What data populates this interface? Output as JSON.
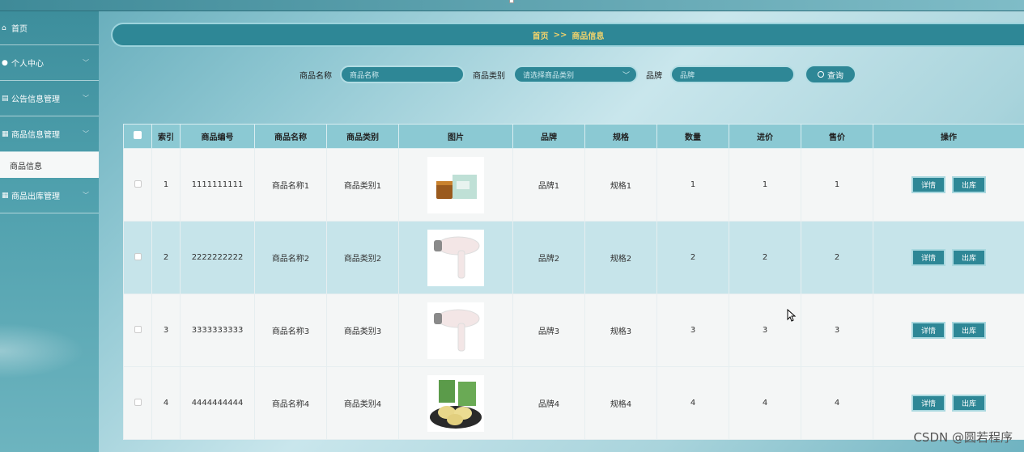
{
  "sidebar": {
    "items": [
      {
        "label": "首页",
        "icon": "home-icon"
      },
      {
        "label": "个人中心",
        "icon": "user-icon"
      },
      {
        "label": "公告信息管理",
        "icon": "notice-icon"
      },
      {
        "label": "商品信息管理",
        "icon": "grid-icon"
      },
      {
        "label": "商品出库管理",
        "icon": "grid-icon"
      }
    ],
    "sub_item": "商品信息"
  },
  "breadcrumb": {
    "home": "首页",
    "sep": ">>",
    "current": "商品信息"
  },
  "search": {
    "name_label": "商品名称",
    "name_placeholder": "商品名称",
    "category_label": "商品类别",
    "category_placeholder": "请选择商品类别",
    "brand_label": "品牌",
    "brand_placeholder": "品牌",
    "button": "查询"
  },
  "table": {
    "headers": [
      "索引",
      "商品编号",
      "商品名称",
      "商品类别",
      "图片",
      "品牌",
      "规格",
      "数量",
      "进价",
      "售价",
      "操作"
    ],
    "rows": [
      {
        "index": "1",
        "code": "1111111111",
        "name": "商品名称1",
        "category": "商品类别1",
        "image": "cosmetics-image",
        "brand": "品牌1",
        "spec": "规格1",
        "qty": "1",
        "cost": "1",
        "price": "1"
      },
      {
        "index": "2",
        "code": "2222222222",
        "name": "商品名称2",
        "category": "商品类别2",
        "image": "hair-dryer-image",
        "brand": "品牌2",
        "spec": "规格2",
        "qty": "2",
        "cost": "2",
        "price": "2"
      },
      {
        "index": "3",
        "code": "3333333333",
        "name": "商品名称3",
        "category": "商品类别3",
        "image": "hair-dryer-image",
        "brand": "品牌3",
        "spec": "规格3",
        "qty": "3",
        "cost": "3",
        "price": "3"
      },
      {
        "index": "4",
        "code": "4444444444",
        "name": "商品名称4",
        "category": "商品类别4",
        "image": "pastry-image",
        "brand": "品牌4",
        "spec": "规格4",
        "qty": "4",
        "cost": "4",
        "price": "4"
      }
    ],
    "detail_btn": "详情",
    "outbound_btn": "出库"
  },
  "watermark": "CSDN @圆若程序",
  "colors": {
    "accent": "#2e8796",
    "breadcrumb_text": "#f2d36b",
    "header_bg": "#8bc9d3",
    "row_alt": "#c6e4ea"
  }
}
